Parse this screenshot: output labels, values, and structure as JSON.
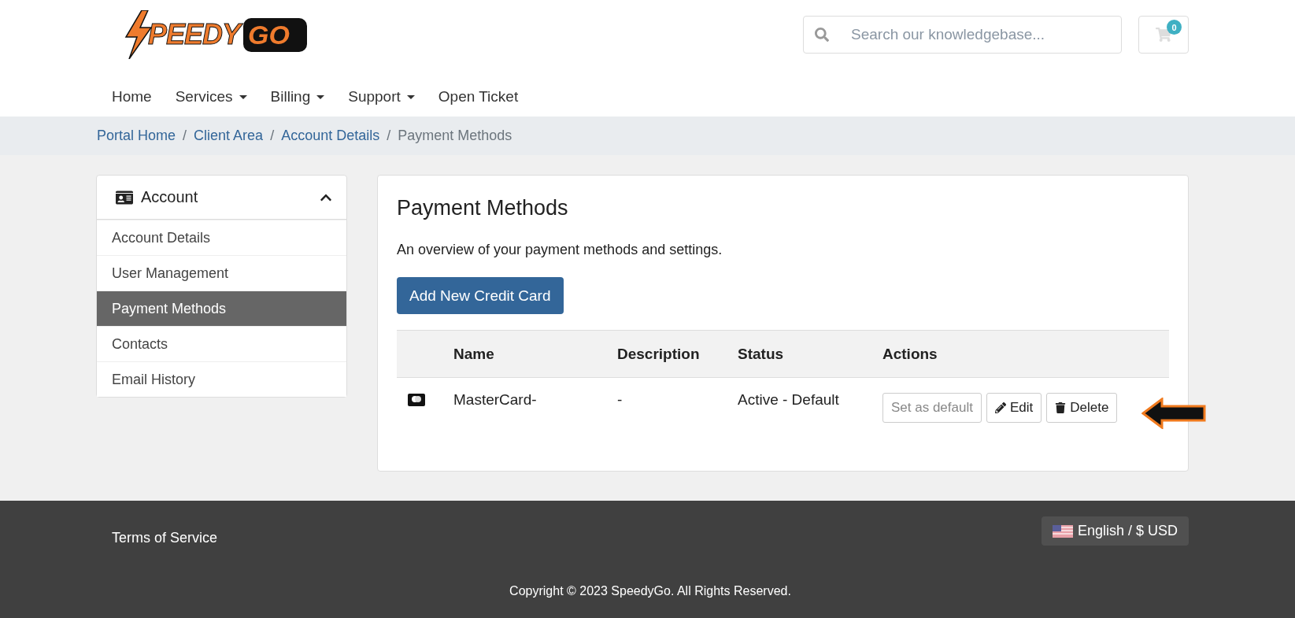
{
  "logo": {
    "text": "PEEDY",
    "badge": "GO"
  },
  "search": {
    "placeholder": "Search our knowledgebase..."
  },
  "cart": {
    "count": "0"
  },
  "nav": [
    {
      "label": "Home",
      "dropdown": false
    },
    {
      "label": "Services",
      "dropdown": true
    },
    {
      "label": "Billing",
      "dropdown": true
    },
    {
      "label": "Support",
      "dropdown": true
    },
    {
      "label": "Open Ticket",
      "dropdown": false
    }
  ],
  "breadcrumb": {
    "separator": "/",
    "items": [
      {
        "label": "Portal Home",
        "current": false
      },
      {
        "label": "Client Area",
        "current": false
      },
      {
        "label": "Account Details",
        "current": false
      },
      {
        "label": "Payment Methods",
        "current": true
      }
    ]
  },
  "sidebar": {
    "title": "Account",
    "expanded": true,
    "items": [
      {
        "label": "Account Details",
        "selected": false
      },
      {
        "label": "User Management",
        "selected": false
      },
      {
        "label": "Payment Methods",
        "selected": true
      },
      {
        "label": "Contacts",
        "selected": false
      },
      {
        "label": "Email History",
        "selected": false
      }
    ]
  },
  "main": {
    "title": "Payment Methods",
    "subtitle": "An overview of your payment methods and settings.",
    "add_button": "Add New Credit Card",
    "table": {
      "columns": [
        "Name",
        "Description",
        "Status",
        "Actions"
      ],
      "rows": [
        {
          "name": "MasterCard-",
          "description": "-",
          "status": "Active - Default",
          "actions": [
            {
              "label": "Set as default",
              "kind": "plain",
              "disabled": true
            },
            {
              "label": "Edit",
              "kind": "edit",
              "disabled": false
            },
            {
              "label": "Delete",
              "kind": "delete",
              "disabled": false
            }
          ]
        }
      ]
    }
  },
  "footer": {
    "links": [
      "Terms of Service"
    ],
    "language": "English / $ USD",
    "copyright": "Copyright © 2023 SpeedyGo. All Rights Reserved."
  }
}
